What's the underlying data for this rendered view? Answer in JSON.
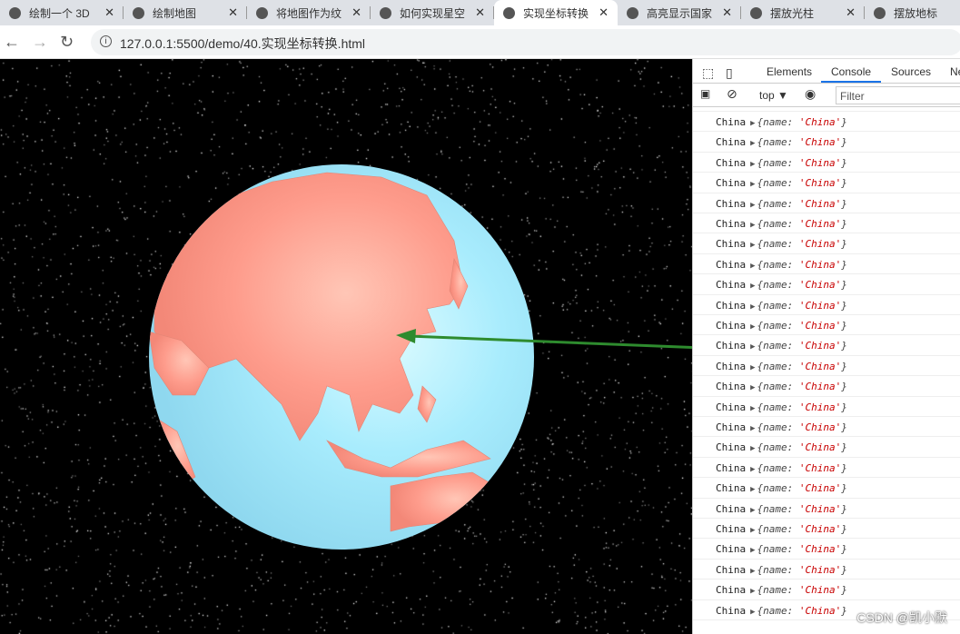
{
  "tabs": [
    {
      "title": "绘制一个 3D",
      "active": false
    },
    {
      "title": "绘制地图",
      "active": false
    },
    {
      "title": "将地图作为纹",
      "active": false
    },
    {
      "title": "如何实现星空",
      "active": false
    },
    {
      "title": "实现坐标转换",
      "active": true
    },
    {
      "title": "高亮显示国家",
      "active": false
    },
    {
      "title": "摆放光柱",
      "active": false
    },
    {
      "title": "摆放地标",
      "active": false
    }
  ],
  "address": {
    "url": "127.0.0.1:5500/demo/40.实现坐标转换.html"
  },
  "devtools": {
    "tabs": [
      "Elements",
      "Console",
      "Sources",
      "Ne"
    ],
    "active_tab": "Console",
    "context": "top ▼",
    "filter_placeholder": "Filter"
  },
  "console": {
    "row_label": "China",
    "row_object_prefix": "{name: ",
    "row_object_value": "'China'",
    "row_object_suffix": "}",
    "row_count": 25
  },
  "colors": {
    "ocean": "#a8ecfd",
    "land": "#fe9c8c",
    "arrow": "#2e8b2e",
    "active_tab_underline": "#1a73e8"
  },
  "watermark": "CSDN @凯小默"
}
